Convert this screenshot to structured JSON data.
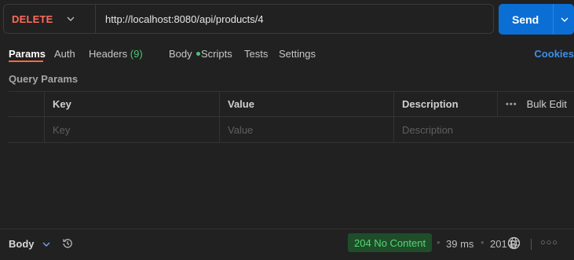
{
  "request": {
    "method": "DELETE",
    "url": "http://localhost:8080/api/products/4",
    "send_label": "Send"
  },
  "tabs": [
    {
      "label": "Params",
      "active": true
    },
    {
      "label": "Auth"
    },
    {
      "label": "Headers",
      "count": "(9)"
    },
    {
      "label": "Body"
    },
    {
      "label": "Scripts"
    },
    {
      "label": "Tests"
    },
    {
      "label": "Settings"
    }
  ],
  "cookies_label": "Cookies",
  "query_params": {
    "title": "Query Params",
    "columns": [
      "Key",
      "Value",
      "Description"
    ],
    "bulk_edit_label": "Bulk Edit",
    "row_placeholders": {
      "key": "Key",
      "value": "Value",
      "description": "Description"
    }
  },
  "response": {
    "body_label": "Body",
    "status": "204 No Content",
    "time": "39 ms",
    "size": "201 B",
    "colors": {
      "status_bg": "#1f4d2a",
      "status_text": "#52d973"
    }
  },
  "icons": [
    "chevron-down-icon",
    "history-icon",
    "globe-icon",
    "more-icon"
  ],
  "colors": {
    "accent": "#0b6ed4",
    "method": "#ff6b5a",
    "tab_underline": "#ff6b3d"
  }
}
